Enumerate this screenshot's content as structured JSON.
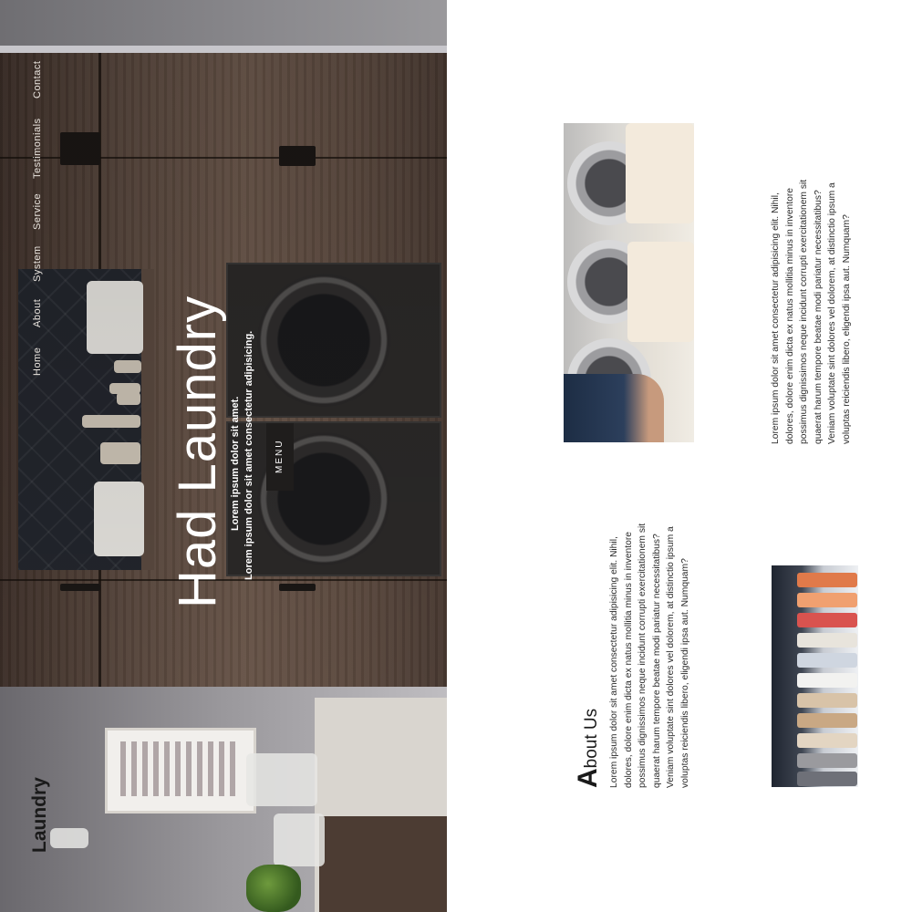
{
  "nav": {
    "items": [
      "Home",
      "About",
      "System",
      "Service",
      "Testimonials",
      "Contact"
    ]
  },
  "hero": {
    "title": "Had Laundry",
    "subtitle_line1": "Lorem ipsum dolor sit amet.",
    "subtitle_line2": "Lorem ipsum dolor sit amet consectetur adipisicing.",
    "menu_label": "MENU"
  },
  "brand": {
    "name": "Laundry"
  },
  "about": {
    "title_initial": "A",
    "title_rest": "bout Us",
    "paragraph_lines": [
      "Lorem ipsum dolor sit amet consectetur adipisicing elit. Nihil,",
      "dolores, dolore enim dicta ex natus mollitia minus in inventore",
      "possimus dignissimos neque incidunt corrupti exercitationem sit",
      "quaerat harum tempore beatae modi pariatur necessitatibus?",
      "Veniam voluptate sint dolores vel dolorem, at distinctio ipsum a",
      "voluptas reiciendis libero, eligendi ipsa aut. Numquam?"
    ]
  },
  "second_block": {
    "paragraph_lines": [
      "Lorem ipsum dolor sit amet consectetur adipisicing elit. Nihil,",
      "dolores, dolore enim dicta ex natus mollitia minus in inventore",
      "possimus dignissimos neque incidunt corrupti exercitationem sit",
      "quaerat harum tempore beatae modi pariatur necessitatibus?",
      "Veniam voluptate sint dolores vel dolorem, at distinctio ipsum a",
      "voluptas reiciendis libero, eligendi ipsa aut. Numquam?"
    ]
  },
  "images": {
    "hero": "laundry-room-photo",
    "photo1": "laundromat-folding-clothes-photo",
    "photo2": "hanging-shirts-rack-photo"
  },
  "colors": {
    "text_dark": "#1a1a1a",
    "hero_text": "#ffffff",
    "menu_bg": "#1f1d1c"
  }
}
